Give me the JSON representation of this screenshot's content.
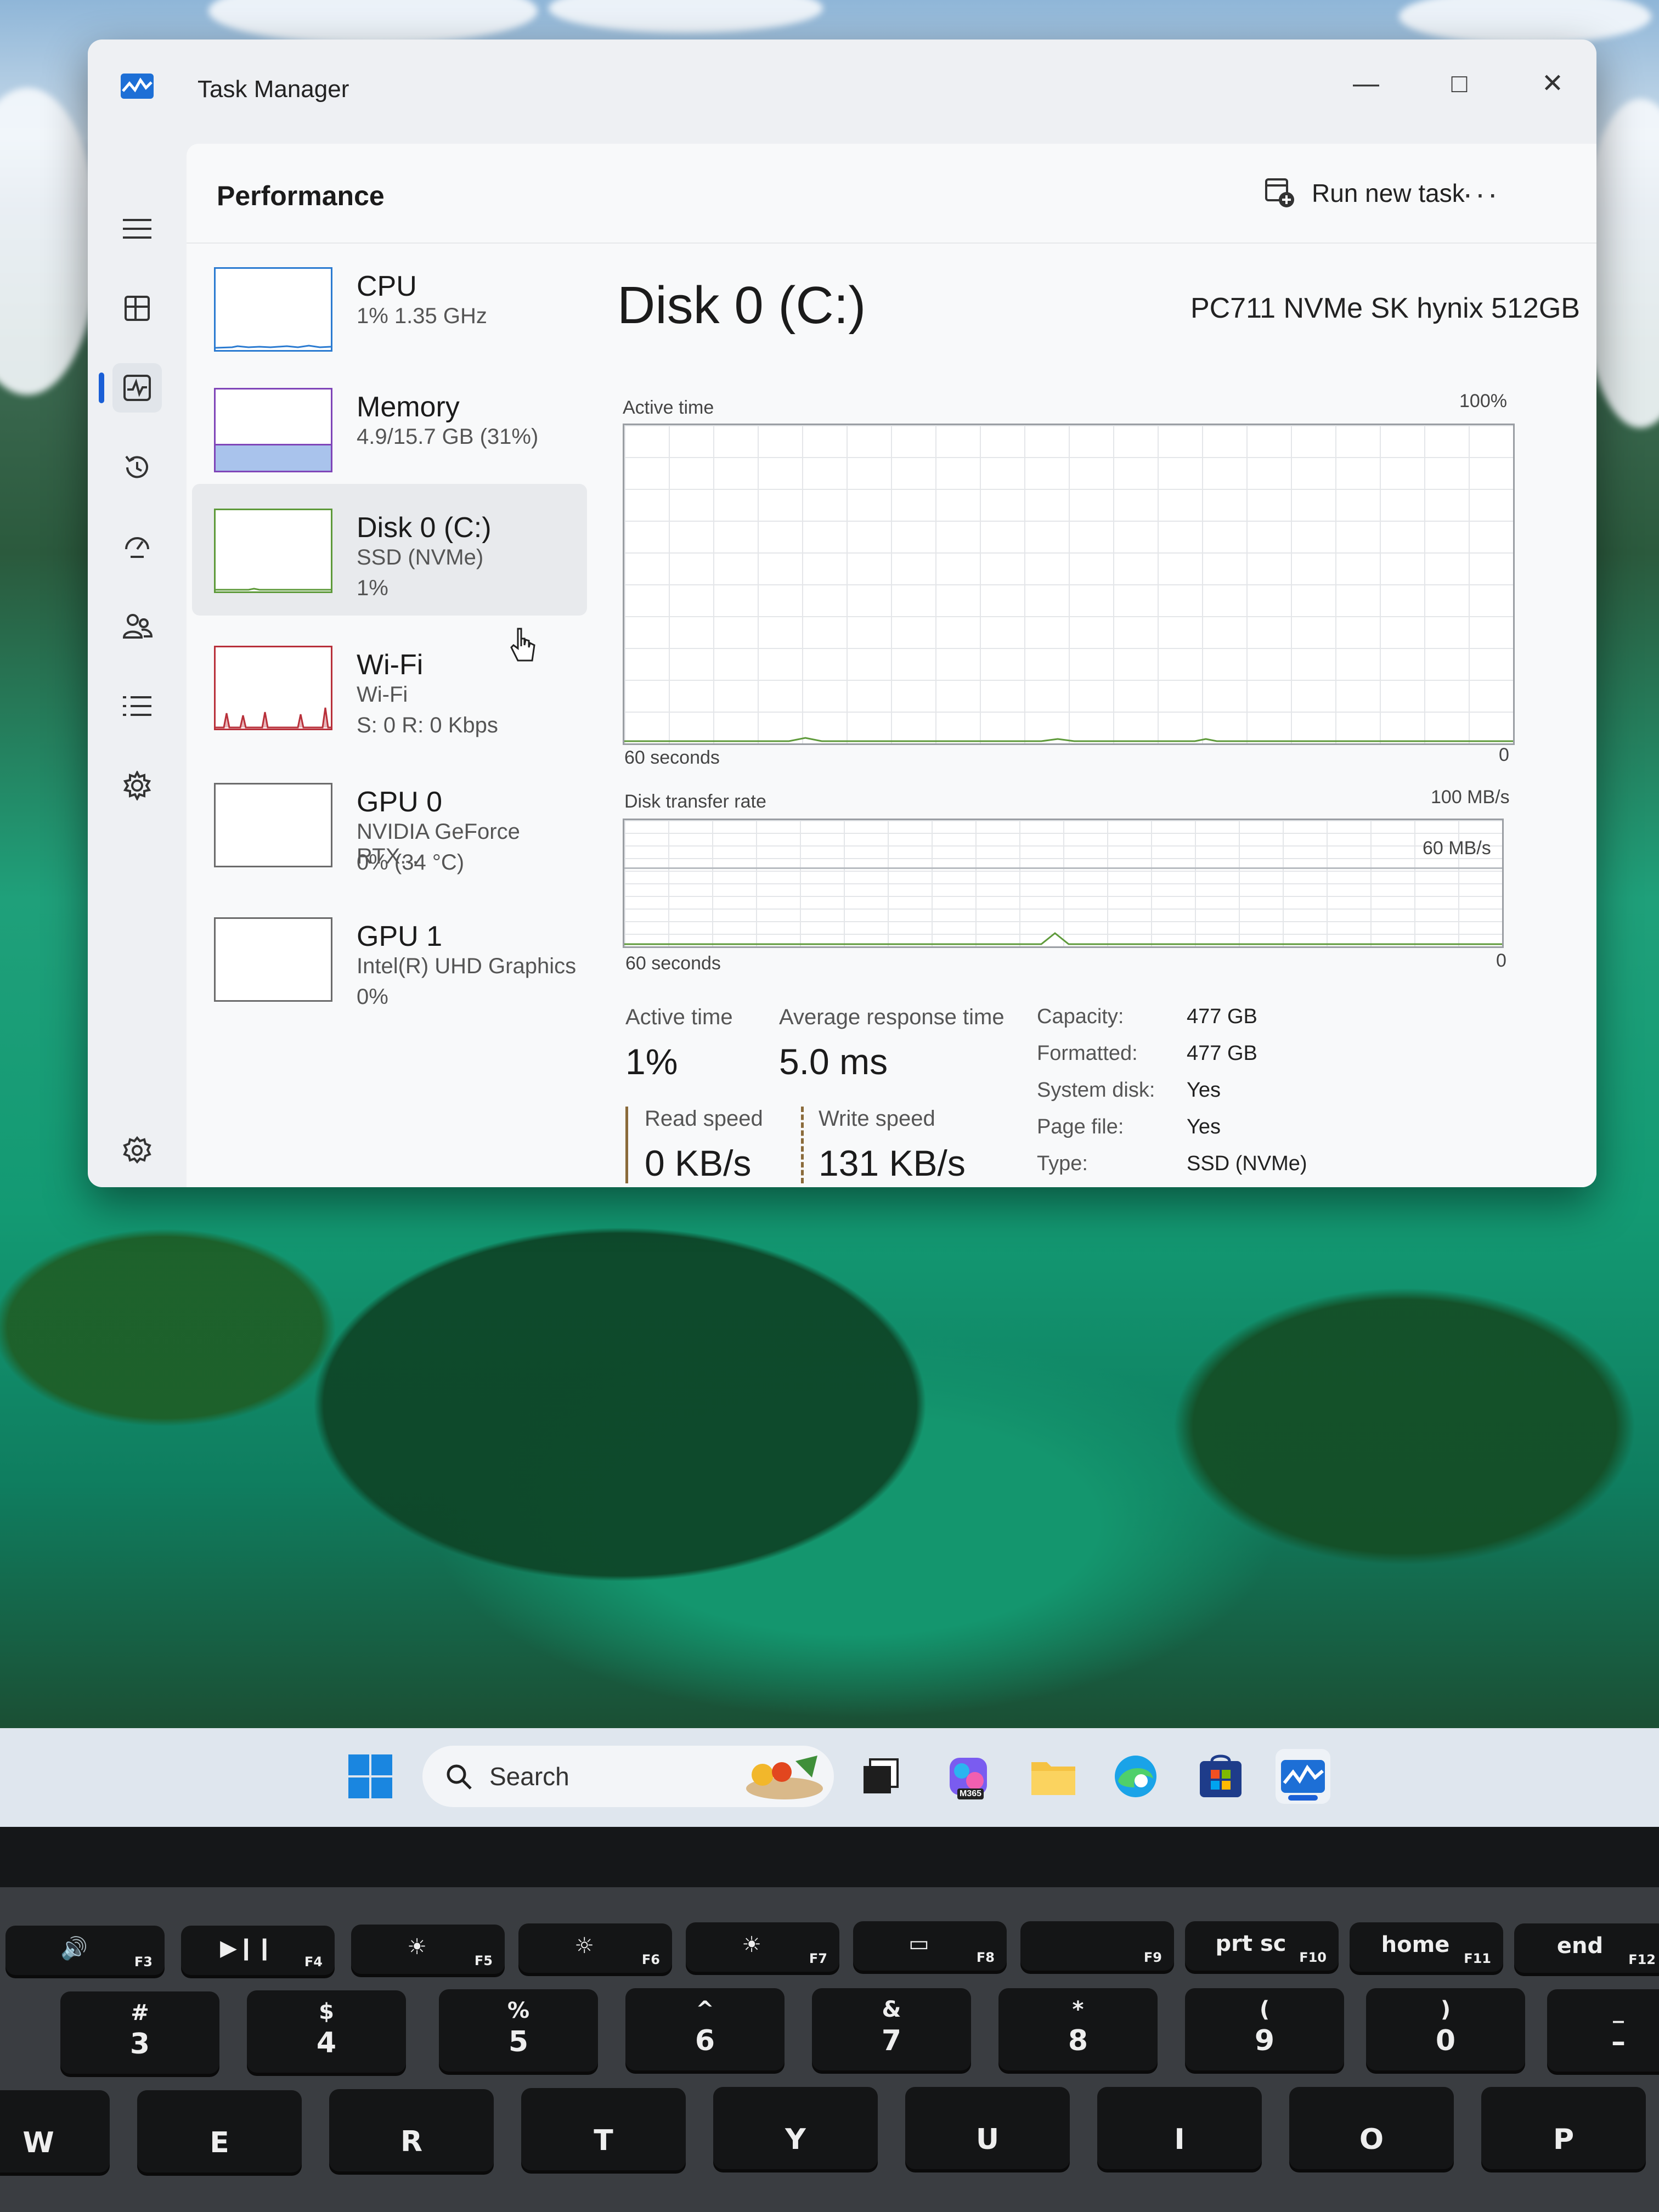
{
  "window": {
    "title": "Task Manager",
    "minimize": "—",
    "maximize": "□",
    "close": "✕"
  },
  "header": {
    "page_title": "Performance",
    "run_new_task": "Run new task",
    "more": "···"
  },
  "devices": [
    {
      "name": "CPU",
      "sub1": "1%  1.35 GHz",
      "sub2": ""
    },
    {
      "name": "Memory",
      "sub1": "4.9/15.7 GB (31%)",
      "sub2": ""
    },
    {
      "name": "Disk 0 (C:)",
      "sub1": "SSD (NVMe)",
      "sub2": "1%"
    },
    {
      "name": "Wi-Fi",
      "sub1": "Wi-Fi",
      "sub2": "S: 0  R: 0 Kbps"
    },
    {
      "name": "GPU 0",
      "sub1": "NVIDIA GeForce RTX...",
      "sub2": "0%  (34 °C)"
    },
    {
      "name": "GPU 1",
      "sub1": "Intel(R) UHD Graphics",
      "sub2": "0%"
    }
  ],
  "detail": {
    "title": "Disk 0 (C:)",
    "model": "PC711 NVMe SK hynix 512GB",
    "active_time_graph": {
      "label": "Active time",
      "max": "100%",
      "min": "0",
      "span": "60 seconds"
    },
    "transfer_graph": {
      "label": "Disk transfer rate",
      "max": "100 MB/s",
      "mid": "60 MB/s",
      "min": "0",
      "span": "60 seconds"
    },
    "stats": {
      "active_time_label": "Active time",
      "active_time_value": "1%",
      "avg_response_label": "Average response time",
      "avg_response_value": "5.0 ms",
      "read_label": "Read speed",
      "read_value": "0 KB/s",
      "write_label": "Write speed",
      "write_value": "131 KB/s"
    },
    "properties": [
      {
        "key": "Capacity:",
        "value": "477 GB"
      },
      {
        "key": "Formatted:",
        "value": "477 GB"
      },
      {
        "key": "System disk:",
        "value": "Yes"
      },
      {
        "key": "Page file:",
        "value": "Yes"
      },
      {
        "key": "Type:",
        "value": "SSD (NVMe)"
      }
    ]
  },
  "taskbar": {
    "search_placeholder": "Search",
    "copilot_badge": "M365"
  },
  "keyboard": {
    "fn_row": [
      {
        "icon": "🔊",
        "label": "F3"
      },
      {
        "icon": "▶❙❙",
        "label": "F4"
      },
      {
        "icon": "☀",
        "label": "F5"
      },
      {
        "icon": "☼",
        "label": "F6"
      },
      {
        "icon": "☀",
        "label": "F7"
      },
      {
        "icon": "▭",
        "label": "F8"
      },
      {
        "icon": "",
        "label": "F9"
      },
      {
        "icon": "prt sc",
        "label": "F10"
      },
      {
        "icon": "home",
        "label": "F11"
      },
      {
        "icon": "end",
        "label": "F12"
      }
    ],
    "number_row": [
      {
        "shift": "#",
        "main": "3"
      },
      {
        "shift": "$",
        "main": "4"
      },
      {
        "shift": "%",
        "main": "5"
      },
      {
        "shift": "^",
        "main": "6"
      },
      {
        "shift": "&",
        "main": "7"
      },
      {
        "shift": "*",
        "main": "8"
      },
      {
        "shift": "(",
        "main": "9"
      },
      {
        "shift": ")",
        "main": "0"
      },
      {
        "shift": "_",
        "main": "–"
      }
    ],
    "letter_row": [
      "W",
      "E",
      "R",
      "T",
      "Y",
      "U",
      "I",
      "O",
      "P"
    ]
  }
}
